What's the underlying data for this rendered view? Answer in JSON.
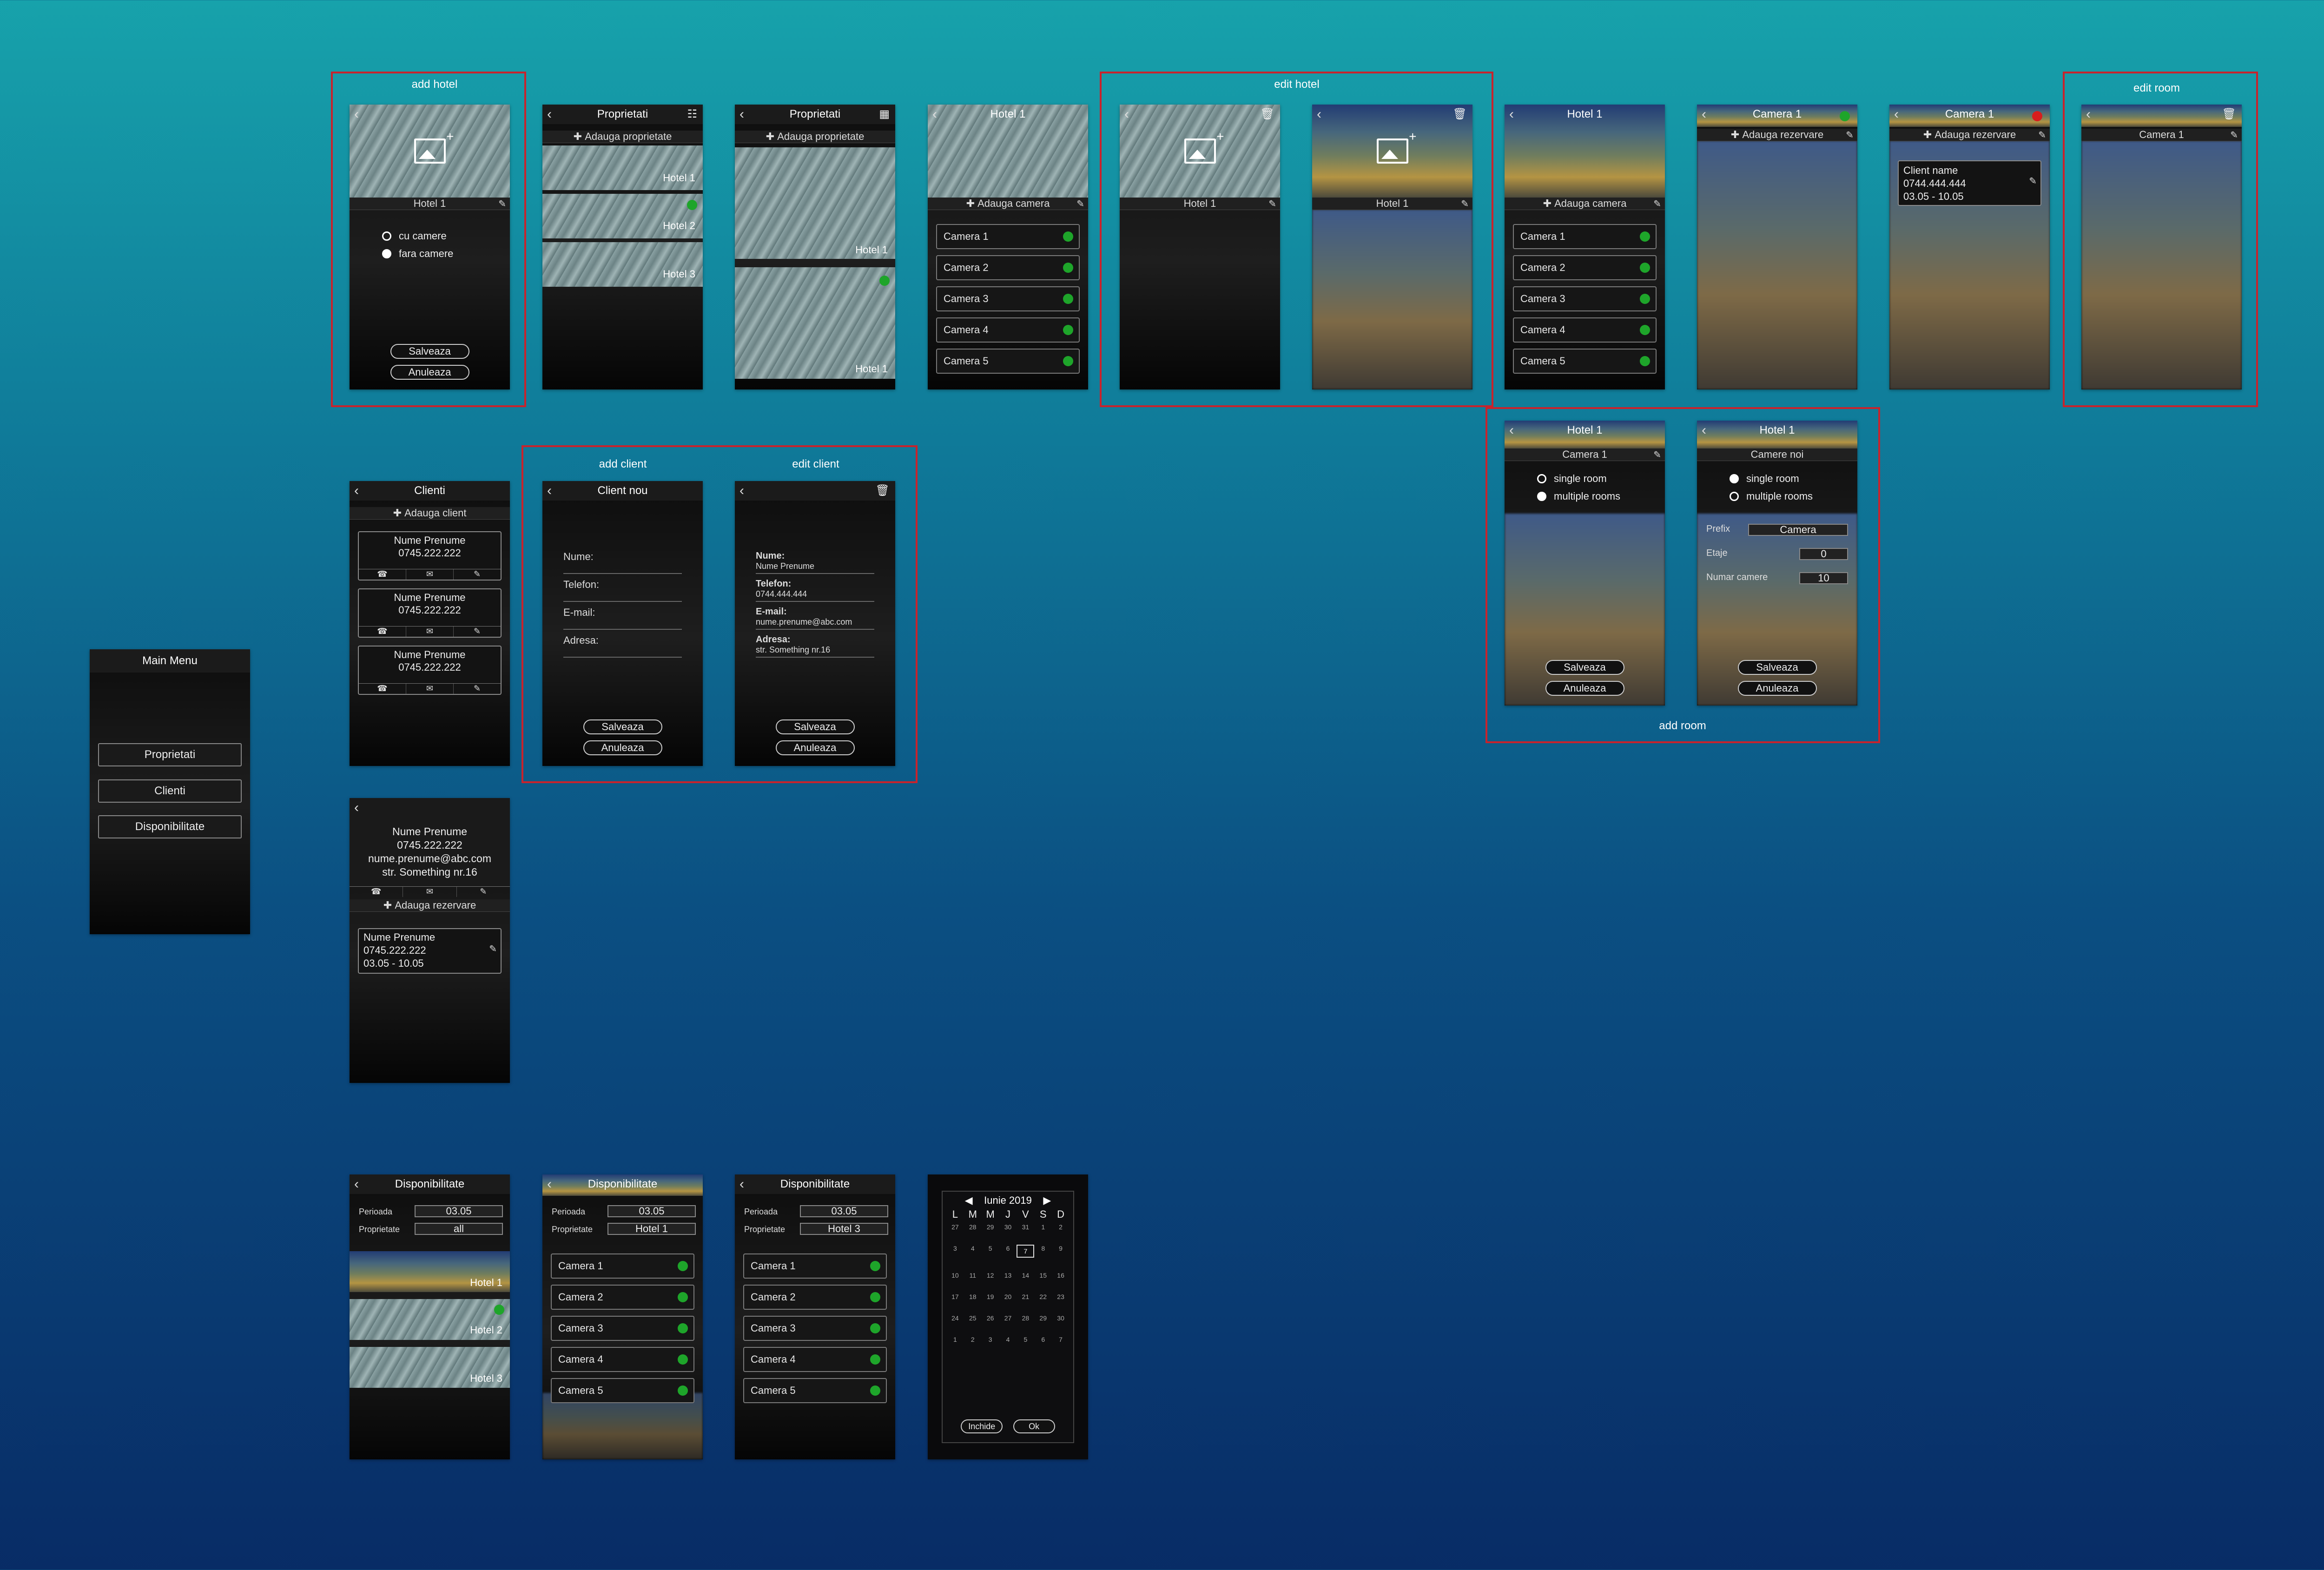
{
  "labels": {
    "add_hotel": "add hotel",
    "edit_hotel": "edit hotel",
    "edit_room": "edit room",
    "add_client": "add client",
    "edit_client": "edit client",
    "add_room": "add room"
  },
  "main_menu": {
    "title": "Main Menu",
    "items": [
      "Proprietati",
      "Clienti",
      "Disponibilitate"
    ]
  },
  "add_hotel": {
    "name": "Hotel 1",
    "opt1": "cu camere",
    "opt2": "fara camere",
    "save": "Salveaza",
    "cancel": "Anuleaza"
  },
  "proprietati_list": {
    "title": "Proprietati",
    "add": "Adauga proprietate",
    "hotels": [
      "Hotel 1",
      "Hotel 2",
      "Hotel 3"
    ]
  },
  "proprietati_grid": {
    "title": "Proprietati",
    "add": "Adauga proprietate",
    "hotels": [
      "Hotel 1",
      "Hotel 1"
    ]
  },
  "hotel_view": {
    "title": "Hotel 1",
    "add": "Adauga camera",
    "rooms": [
      "Camera 1",
      "Camera 2",
      "Camera 3",
      "Camera 4",
      "Camera 5"
    ]
  },
  "edit_hotel": {
    "name": "Hotel 1"
  },
  "camera_view": {
    "title": "Camera 1",
    "add": "Adauga rezervare"
  },
  "camera_booked": {
    "title": "Camera 1",
    "add": "Adauga rezervare",
    "client": "Client name",
    "phone": "0744.444.444",
    "dates": "03.05 - 10.05"
  },
  "edit_room": {
    "label": "Camera 1"
  },
  "clienti": {
    "title": "Clienti",
    "add": "Adauga client",
    "items": [
      {
        "name": "Nume Prenume",
        "phone": "0745.222.222"
      },
      {
        "name": "Nume Prenume",
        "phone": "0745.222.222"
      },
      {
        "name": "Nume Prenume",
        "phone": "0745.222.222"
      }
    ]
  },
  "client_nou": {
    "title": "Client nou",
    "f1": "Nume:",
    "f2": "Telefon:",
    "f3": "E-mail:",
    "f4": "Adresa:",
    "save": "Salveaza",
    "cancel": "Anuleaza"
  },
  "edit_client": {
    "f1": "Nume:",
    "v1": "Nume Prenume",
    "f2": "Telefon:",
    "v2": "0744.444.444",
    "f3": "E-mail:",
    "v3": "nume.prenume@abc.com",
    "f4": "Adresa:",
    "v4": "str. Something nr.16",
    "save": "Salveaza",
    "cancel": "Anuleaza"
  },
  "client_detail": {
    "name": "Nume Prenume",
    "phone": "0745.222.222",
    "email": "nume.prenume@abc.com",
    "addr": "str. Something nr.16",
    "add": "Adauga rezervare",
    "booking": {
      "name": "Nume Prenume",
      "phone": "0745.222.222",
      "dates": "03.05 - 10.05"
    }
  },
  "add_room_single": {
    "hotel": "Hotel 1",
    "room": "Camera 1",
    "opt1": "single room",
    "opt2": "multiple rooms",
    "save": "Salveaza",
    "cancel": "Anuleaza"
  },
  "add_room_multi": {
    "hotel": "Hotel 1",
    "title": "Camere noi",
    "opt1": "single room",
    "opt2": "multiple rooms",
    "prefix_l": "Prefix",
    "prefix_v": "Camera",
    "etaje_l": "Etaje",
    "etaje_v": "0",
    "numar_l": "Numar camere",
    "numar_v": "10",
    "save": "Salveaza",
    "cancel": "Anuleaza"
  },
  "disp1": {
    "title": "Disponibilitate",
    "perioada_l": "Perioada",
    "perioada_v": "03.05",
    "prop_l": "Proprietate",
    "prop_v": "all",
    "hotels": [
      "Hotel 1",
      "Hotel 2",
      "Hotel 3"
    ]
  },
  "disp2": {
    "title": "Disponibilitate",
    "perioada_l": "Perioada",
    "perioada_v": "03.05",
    "prop_l": "Proprietate",
    "prop_v": "Hotel 1",
    "rooms": [
      "Camera 1",
      "Camera 2",
      "Camera 3",
      "Camera 4",
      "Camera 5"
    ]
  },
  "disp3": {
    "title": "Disponibilitate",
    "perioada_l": "Perioada",
    "perioada_v": "03.05",
    "prop_l": "Proprietate",
    "prop_v": "Hotel 3",
    "rooms": [
      "Camera 1",
      "Camera 2",
      "Camera 3",
      "Camera 4",
      "Camera 5"
    ]
  },
  "calendar": {
    "month": "Iunie 2019",
    "days": [
      "L",
      "M",
      "M",
      "J",
      "V",
      "S",
      "D"
    ],
    "cells": [
      "27",
      "28",
      "29",
      "30",
      "31",
      "1",
      "2",
      "3",
      "4",
      "5",
      "6",
      "7",
      "8",
      "9",
      "10",
      "11",
      "12",
      "13",
      "14",
      "15",
      "16",
      "17",
      "18",
      "19",
      "20",
      "21",
      "22",
      "23",
      "24",
      "25",
      "26",
      "27",
      "28",
      "29",
      "30",
      "1",
      "2",
      "3",
      "4",
      "5",
      "6",
      "7"
    ],
    "close": "Inchide",
    "ok": "Ok"
  },
  "colors": {
    "accent_green": "#1ea52a",
    "alert_red": "#d81d1d",
    "highlight_border": "#c8232c"
  }
}
